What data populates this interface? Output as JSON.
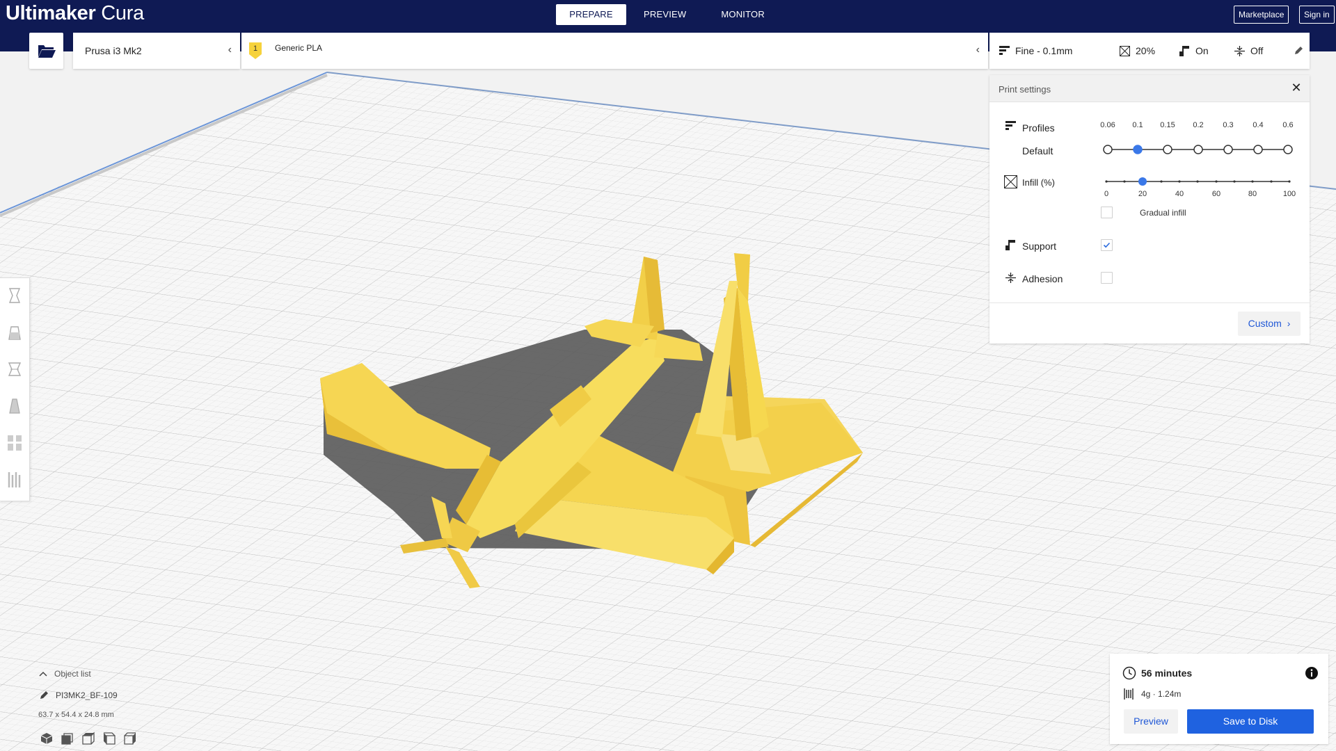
{
  "app": {
    "name_bold": "Ultimaker",
    "name_light": "Cura"
  },
  "stages": [
    {
      "label": "PREPARE",
      "active": true
    },
    {
      "label": "PREVIEW",
      "active": false
    },
    {
      "label": "MONITOR",
      "active": false
    }
  ],
  "header_buttons": {
    "marketplace": "Marketplace",
    "signin": "Sign in"
  },
  "machine": {
    "name": "Prusa i3 Mk2"
  },
  "material": {
    "extruder": "1",
    "name": "Generic PLA",
    "color": "#f6d23c"
  },
  "summary": {
    "profile": "Fine - 0.1mm",
    "infill": "20%",
    "support": "On",
    "adhesion": "Off"
  },
  "print_settings": {
    "title": "Print settings",
    "profiles": {
      "label": "Profiles",
      "sublabel": "Default",
      "ticks": [
        "0.06",
        "0.1",
        "0.15",
        "0.2",
        "0.3",
        "0.4",
        "0.6"
      ],
      "selected_index": 1
    },
    "infill": {
      "label": "Infill (%)",
      "ticks": [
        "0",
        "20",
        "40",
        "60",
        "80",
        "100"
      ],
      "value": 20,
      "gradual_label": "Gradual infill",
      "gradual_checked": false
    },
    "support": {
      "label": "Support",
      "checked": true
    },
    "adhesion": {
      "label": "Adhesion",
      "checked": false
    },
    "custom_button": "Custom"
  },
  "object_list": {
    "toggle_label": "Object list",
    "object_name": "PI3MK2_BF-109",
    "dimensions": "63.7 x 54.4 x 24.8 mm"
  },
  "job": {
    "time": "56 minutes",
    "material_usage": "4g · 1.24m",
    "preview_button": "Preview",
    "save_button": "Save to Disk"
  },
  "colors": {
    "header_bg": "#0f1a54",
    "accent_blue": "#1f62e0",
    "model_yellow": "#f5d74a",
    "shadow_gray": "#5c5c5c"
  },
  "icons": {
    "open_file": "folder-open-icon",
    "profile": "profile-icon",
    "infill": "infill-icon",
    "support": "support-icon",
    "adhesion": "adhesion-icon",
    "clock": "clock-icon",
    "spool": "spool-icon",
    "info": "info-icon"
  }
}
